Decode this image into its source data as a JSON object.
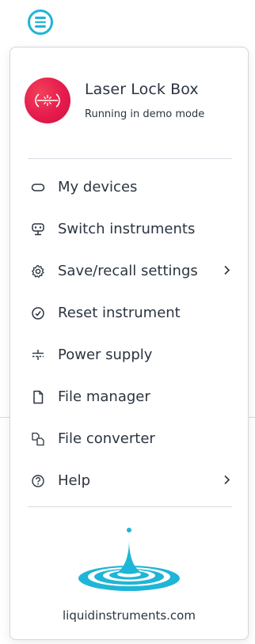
{
  "instrument": {
    "name": "Laser Lock Box",
    "status": "Running in demo mode"
  },
  "menu": [
    {
      "label": "My devices",
      "icon": "devices-icon",
      "submenu": false
    },
    {
      "label": "Switch instruments",
      "icon": "switch-instruments-icon",
      "submenu": false
    },
    {
      "label": "Save/recall settings",
      "icon": "gear-icon",
      "submenu": true
    },
    {
      "label": "Reset instrument",
      "icon": "reset-icon",
      "submenu": false
    },
    {
      "label": "Power supply",
      "icon": "power-supply-icon",
      "submenu": false
    },
    {
      "label": "File manager",
      "icon": "file-icon",
      "submenu": false
    },
    {
      "label": "File converter",
      "icon": "file-converter-icon",
      "submenu": false
    },
    {
      "label": "Help",
      "icon": "help-icon",
      "submenu": true
    }
  ],
  "footer": {
    "website": "liquidinstruments.com"
  },
  "colors": {
    "accent": "#1fb5d6",
    "instrument_badge": "#e51b4d",
    "logo": "#1fb5d6",
    "text": "#2b3440"
  }
}
